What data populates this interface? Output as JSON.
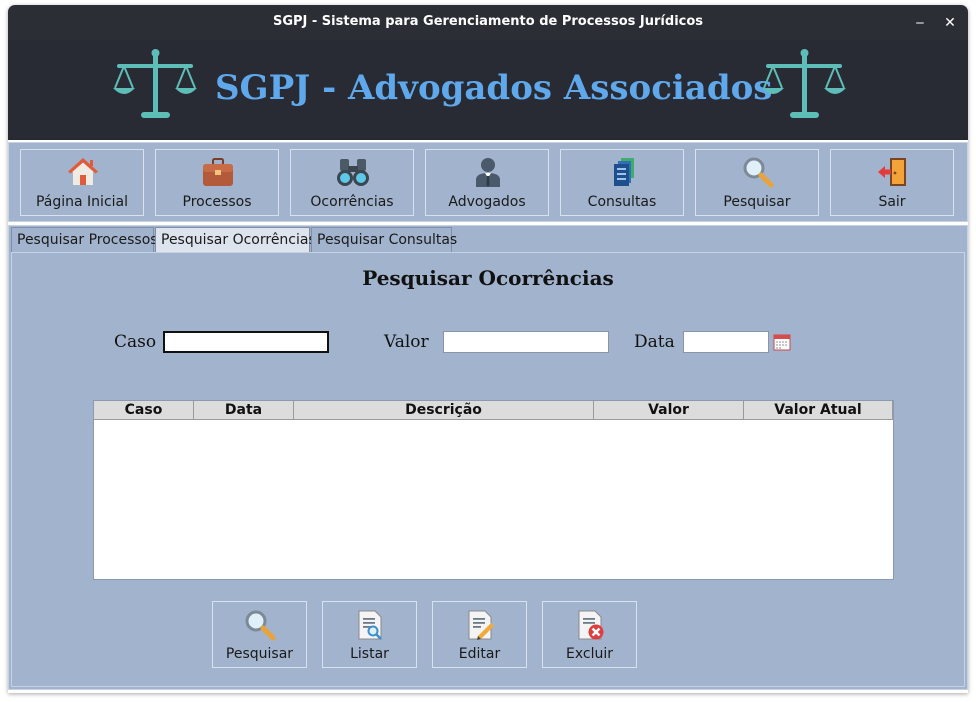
{
  "window": {
    "title": "SGPJ - Sistema para Gerenciamento de Processos Jurídicos",
    "minimize_glyph": "‒",
    "close_glyph": "✕"
  },
  "banner": {
    "title": "SGPJ - Advogados Associados",
    "left_icon": "scales-of-justice-icon",
    "right_icon": "scales-of-justice-icon",
    "color": "#5fa8ec"
  },
  "toolbar": {
    "items": [
      {
        "label": "Página Inicial",
        "icon": "home-icon"
      },
      {
        "label": "Processos",
        "icon": "briefcase-icon"
      },
      {
        "label": "Ocorrências",
        "icon": "binoculars-icon"
      },
      {
        "label": "Advogados",
        "icon": "lawyer-icon"
      },
      {
        "label": "Consultas",
        "icon": "documents-icon"
      },
      {
        "label": "Pesquisar",
        "icon": "magnifier-icon"
      },
      {
        "label": "Sair",
        "icon": "exit-door-icon"
      }
    ]
  },
  "tabs": [
    {
      "label": "Pesquisar Processos",
      "active": false
    },
    {
      "label": "Pesquisar Ocorrências",
      "active": true
    },
    {
      "label": "Pesquisar Consultas",
      "active": false
    }
  ],
  "form": {
    "title": "Pesquisar Ocorrências",
    "fields": {
      "caso": {
        "label": "Caso",
        "value": ""
      },
      "valor": {
        "label": "Valor",
        "value": ""
      },
      "data": {
        "label": "Data",
        "value": "",
        "picker_icon": "calendar-icon"
      }
    }
  },
  "table": {
    "columns": [
      "Caso",
      "Data",
      "Descrição",
      "Valor",
      "Valor Atual"
    ],
    "rows": []
  },
  "actions": [
    {
      "label": "Pesquisar",
      "icon": "magnifier-icon"
    },
    {
      "label": "Listar",
      "icon": "list-document-icon"
    },
    {
      "label": "Editar",
      "icon": "edit-document-icon"
    },
    {
      "label": "Excluir",
      "icon": "delete-document-icon"
    }
  ],
  "colors": {
    "background": "#a2b3cd",
    "banner": "#282b33",
    "titlebar": "#2b2e35"
  }
}
